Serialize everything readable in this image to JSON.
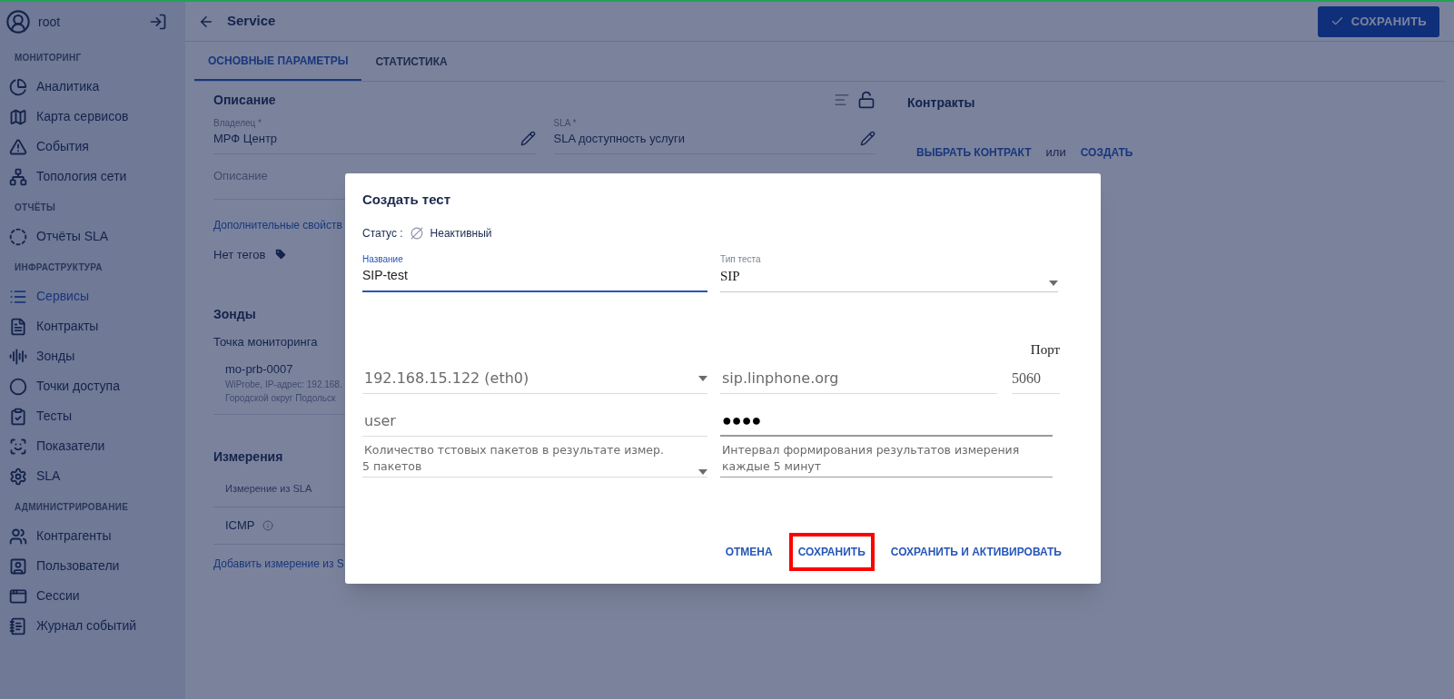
{
  "user": {
    "name": "root"
  },
  "sidebar": {
    "sections": [
      {
        "title": "МОНИТОРИНГ",
        "items": [
          {
            "label": "Аналитика",
            "selected": false
          },
          {
            "label": "Карта сервисов",
            "selected": false
          },
          {
            "label": "События",
            "selected": false
          },
          {
            "label": "Топология сети",
            "selected": false
          }
        ]
      },
      {
        "title": "ОТЧЁТЫ",
        "items": [
          {
            "label": "Отчёты SLA",
            "selected": false
          }
        ]
      },
      {
        "title": "ИНФРАСТРУКТУРА",
        "items": [
          {
            "label": "Сервисы",
            "selected": true
          },
          {
            "label": "Контракты",
            "selected": false
          },
          {
            "label": "Зонды",
            "selected": false
          },
          {
            "label": "Точки доступа",
            "selected": false
          },
          {
            "label": "Тесты",
            "selected": false
          },
          {
            "label": "Показатели",
            "selected": false
          },
          {
            "label": "SLA",
            "selected": false
          }
        ]
      },
      {
        "title": "АДМИНИСТРИРОВАНИЕ",
        "items": [
          {
            "label": "Контрагенты",
            "selected": false
          },
          {
            "label": "Пользователи",
            "selected": false
          },
          {
            "label": "Сессии",
            "selected": false
          },
          {
            "label": "Журнал событий",
            "selected": false
          }
        ]
      }
    ]
  },
  "header": {
    "title": "Service",
    "save_button": "СОХРАНИТЬ"
  },
  "tabs": [
    {
      "label": "ОСНОВНЫЕ ПАРАМЕТРЫ",
      "selected": true
    },
    {
      "label": "СТАТИСТИКА",
      "selected": false
    }
  ],
  "description": {
    "title": "Описание",
    "owner": {
      "label": "Владелец *",
      "value": "МРФ Центр"
    },
    "sla": {
      "label": "SLA *",
      "value": "SLA доступность услуги"
    },
    "description_placeholder": "Описание",
    "extra_link": "Дополнительные свойств",
    "tags": "Нет тегов"
  },
  "probes": {
    "title": "Зонды",
    "point_label": "Точка мониторинга",
    "probe": {
      "name": "mo-prb-0007",
      "line_1": "WiProbe, IP-адрес: 192.168.",
      "line_2": "Городской округ Подольск"
    }
  },
  "measurements": {
    "title": "Измерения",
    "column": "Измерение из SLA",
    "rows": [
      "ICMP"
    ],
    "add_link": "Добавить измерение из S"
  },
  "contracts": {
    "title": "Контракты",
    "choose_link": "ВЫБРАТЬ КОНТРАКТ",
    "or": "или",
    "create_link": "СОЗДАТЬ"
  },
  "dialog": {
    "title": "Создать тест",
    "status_label": "Статус :",
    "status": "Неактивный",
    "name": {
      "label": "Название",
      "value": "SIP-test",
      "focused": true
    },
    "test_type": {
      "label": "Тип теста",
      "value": "SIP"
    },
    "interface": {
      "value": "192.168.15.122 (eth0)"
    },
    "server": {
      "value": "sip.linphone.org"
    },
    "port": {
      "label": "Порт",
      "value": "5060"
    },
    "user": {
      "value": "user"
    },
    "password": {
      "value": "●●●●"
    },
    "packets": {
      "label": "Количество тстовых пакетов в результате измер.",
      "value": "5 пакетов"
    },
    "interval": {
      "label": "Интервал формирования результатов измерения",
      "value": "каждые 5 минут"
    },
    "buttons": [
      {
        "label": "ОТМЕНА",
        "highlighted": false
      },
      {
        "label": "СОХРАНИТЬ",
        "highlighted": true
      },
      {
        "label": "СОХРАНИТЬ И АКТИВИРОВАТЬ",
        "highlighted": false
      }
    ]
  }
}
